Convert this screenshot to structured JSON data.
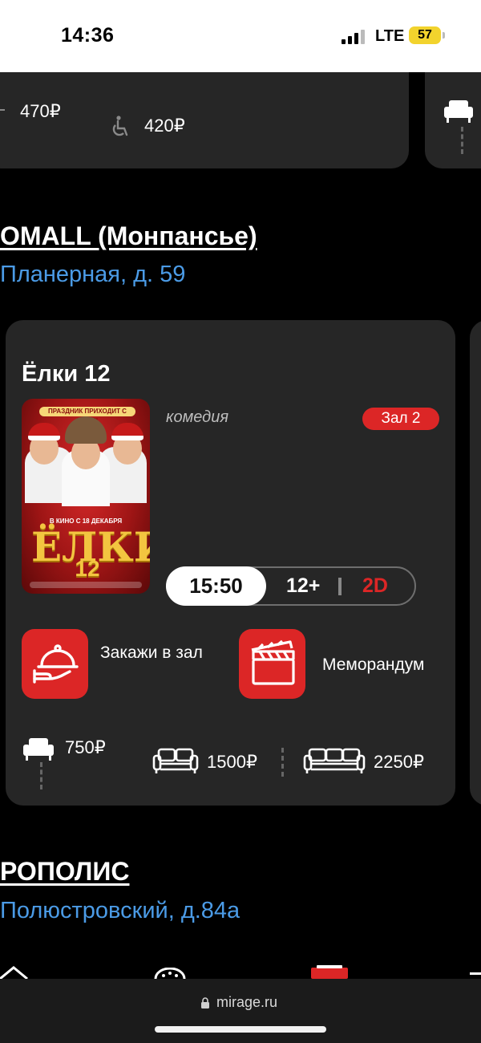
{
  "status_bar": {
    "time": "14:36",
    "network": "LTE",
    "battery": "57"
  },
  "prev_cinema": {
    "prices": [
      "470₽",
      "420₽"
    ]
  },
  "cinemas": [
    {
      "name": "OMALL (Монпансье)",
      "address": "Планерная, д. 59"
    },
    {
      "name": "РОПОЛИС",
      "address": "Полюстровский, д.84а"
    }
  ],
  "movie": {
    "title": "Ёлки 12",
    "genre": "комедия",
    "hall": "Зал 2",
    "poster": {
      "tagline": "ПРАЗДНИК ПРИХОДИТ С НАМИ!",
      "date": "В КИНО С 18 ДЕКАБРЯ",
      "logo": "ЁЛКИ",
      "number": "12"
    },
    "session": {
      "time": "15:50",
      "age": "12+",
      "format": "2D"
    },
    "actions": [
      {
        "label": "Закажи в зал",
        "icon": "cloche-serving-icon"
      },
      {
        "label": "Меморандум",
        "icon": "clapperboard-icon"
      }
    ],
    "prices": [
      {
        "icon": "armchair-icon",
        "value": "750₽"
      },
      {
        "icon": "sofa-two-icon",
        "value": "1500₽"
      },
      {
        "icon": "sofa-three-icon",
        "value": "2250₽"
      }
    ]
  },
  "browser": {
    "url": "mirage.ru"
  },
  "colors": {
    "accent": "#dc2626",
    "link": "#4b9be6",
    "card": "#262626",
    "background": "#000000"
  }
}
